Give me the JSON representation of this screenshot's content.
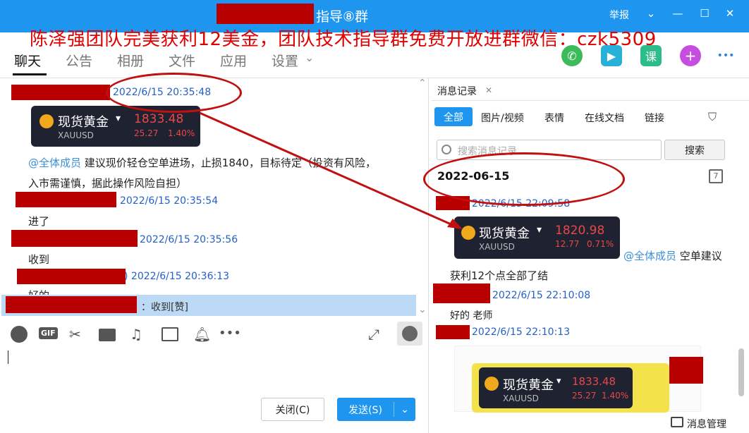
{
  "window": {
    "title": "指导⑧群",
    "report_label": "举报",
    "controls": [
      "⌄",
      "—",
      "☐",
      "✕"
    ]
  },
  "banner": "陈泽强团队完美获利12美金，团队技术指导群免费开放进群微信：czk5309",
  "nav": {
    "tabs": [
      "聊天",
      "公告",
      "相册",
      "文件",
      "应用",
      "设置"
    ],
    "settings_caret": "⌄"
  },
  "top_icons": [
    {
      "name": "phone-icon",
      "glyph": "✆",
      "color": "#3dbb5a"
    },
    {
      "name": "video-icon",
      "glyph": "▶",
      "color": "#27b0d8"
    },
    {
      "name": "lesson-icon",
      "glyph": "课",
      "color": "#2ebc8a"
    },
    {
      "name": "add-app-icon",
      "glyph": "+",
      "color": "#c64de0"
    },
    {
      "name": "more-icon",
      "glyph": "•••",
      "color": "#2f7fe0"
    }
  ],
  "chat": {
    "messages": [
      {
        "time": "2022/6/15 20:35:48"
      },
      {
        "time": "2022/6/15 20:35:54",
        "text": "进了"
      },
      {
        "time": "2022/6/15 20:35:56",
        "text": "收到"
      },
      {
        "time": ") 2022/6/15 20:36:13",
        "text": "好的"
      }
    ],
    "card": {
      "name": "现货黄金",
      "caret": "▾",
      "price": "1833.48",
      "symbol": "XAUUSD",
      "change": "25.27",
      "change_pct": "1.40%"
    },
    "mention": "@全体成员",
    "advice_line1": " 建议现价轻仓空单进场，止损1840，目标待定（投资有风险，",
    "advice_line2": "入市需谨慎，据此操作风险自担）",
    "reply_bar": "：收到[赞]",
    "corner_arrows": "⌃"
  },
  "toolbar": {
    "icons": [
      "emoji-icon",
      "gif-icon",
      "scissors-icon",
      "folder-icon",
      "music-icon",
      "image-icon",
      "bell-icon",
      "dots-icon"
    ],
    "gif_label": "GIF",
    "close_label": "关闭(C)",
    "send_label": "发送(S)",
    "send_caret": "⌄"
  },
  "history": {
    "tab_title": "消息记录",
    "close_glyph": "✕",
    "filters": [
      "全部",
      "图片/视频",
      "表情",
      "在线文档",
      "链接"
    ],
    "search_placeholder": "搜索消息记录",
    "search_button": "搜索",
    "date_header": "2022-06-15",
    "calendar_glyph": "7",
    "entries": [
      {
        "time": "2022/6/15 22:09:58"
      },
      {
        "time": "2022/6/15 22:10:08",
        "text": "好的  老师"
      },
      {
        "time": "2022/6/15 22:10:13"
      }
    ],
    "card": {
      "name": "现货黄金",
      "caret": "▾",
      "price": "1820.98",
      "symbol": "XAUUSD",
      "change": "12.77",
      "change_pct": "0.71%"
    },
    "mention": "@全体成员",
    "mention_text": " 空单建议",
    "profit_text": "获利12个点全部了结",
    "image_card": {
      "name": "现货黄金",
      "caret": "▾",
      "price": "1833.48",
      "symbol": "XAUUSD",
      "change": "25.27",
      "change_pct": "1.40%"
    },
    "manage_label": "消息管理"
  },
  "colors": {
    "titlebar": "#1e96f0",
    "banner": "#e00000",
    "annotation": "#c01010",
    "timestamp": "#2460c8"
  }
}
